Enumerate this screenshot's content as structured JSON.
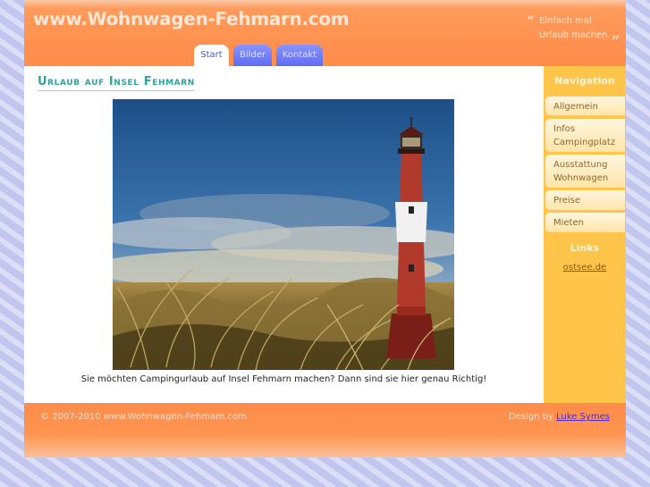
{
  "header": {
    "site_title": "www.Wohnwagen-Fehmarn.com",
    "slogan": "Einfach mal Urlaub machen.",
    "quote_open": "“",
    "quote_close": "”"
  },
  "tabs": [
    {
      "label": "Start",
      "active": true
    },
    {
      "label": "Bilder",
      "active": false
    },
    {
      "label": "Kontakt",
      "active": false
    }
  ],
  "main": {
    "heading": "Urlaub auf Insel Fehmarn",
    "caption": "Sie möchten Campingurlaub auf Insel Fehmarn machen? Dann sind sie hier genau Richtig!"
  },
  "sidebar": {
    "nav_heading": "Navigation",
    "nav_items": [
      {
        "label": "Allgemein"
      },
      {
        "label": "Infos Campingplatz"
      },
      {
        "label": "Ausstattung Wohnwagen"
      },
      {
        "label": "Preise"
      },
      {
        "label": "Mieten"
      }
    ],
    "links_heading": "Links",
    "links": [
      {
        "label": "ostsee.de"
      }
    ]
  },
  "footer": {
    "copyright": "© 2007-2010 www.Wohnwagen-Fehmarn.com",
    "design_prefix": "Design by",
    "designer": "Luke Symes"
  },
  "colors": {
    "header_orange": "#ff8c4a",
    "sidebar_yellow": "#ffc44a",
    "tab_blue": "#6470f5",
    "heading_teal": "#2aa5a0"
  },
  "icons": {
    "hero": "lighthouse-photo"
  }
}
